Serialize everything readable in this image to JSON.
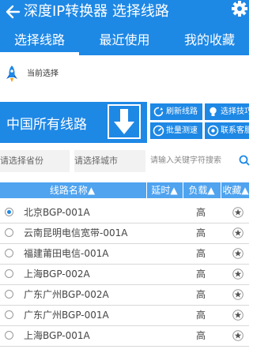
{
  "app": {
    "title": "深度IP转换器 选择线路"
  },
  "tabs": [
    {
      "label": "选择线路"
    },
    {
      "label": "最近使用"
    },
    {
      "label": "我的收藏"
    }
  ],
  "current": {
    "label": "当前选择"
  },
  "panel": {
    "all_lines": "中国所有线路",
    "refresh": "刷新线路",
    "tips": "选择技巧",
    "batch_test": "批量测速",
    "contact": "联系客服"
  },
  "filters": {
    "province": "请选择省份",
    "city": "请选择城市",
    "search_placeholder": "请输入关键字符搜索"
  },
  "table": {
    "headers": [
      "线路名称▲",
      "延时▲",
      "负载▲",
      "收藏▲"
    ],
    "rows": [
      {
        "name": "北京BGP-001A",
        "load": "高",
        "selected": true
      },
      {
        "name": "云南昆明电信宽带-001A",
        "load": "高",
        "selected": false
      },
      {
        "name": "福建莆田电信-001A",
        "load": "高",
        "selected": false
      },
      {
        "name": "上海BGP-002A",
        "load": "高",
        "selected": false
      },
      {
        "name": "广东广州BGP-002A",
        "load": "高",
        "selected": false
      },
      {
        "name": "广东广州BGP-001A",
        "load": "高",
        "selected": false
      },
      {
        "name": "上海BGP-001A",
        "load": "高",
        "selected": false
      }
    ]
  },
  "colors": {
    "accent": "#1E88E5",
    "header": "#4FA3EF"
  }
}
